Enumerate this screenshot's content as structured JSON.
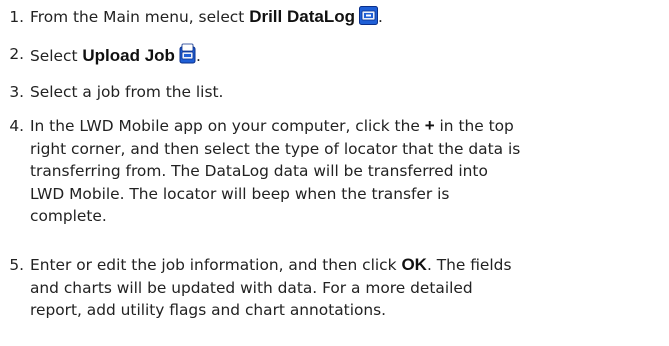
{
  "steps": [
    {
      "number": "1.",
      "prefix": "From the Main menu, select ",
      "emphasis": "Drill DataLog",
      "icon": "drill-datalog-icon",
      "suffix": "."
    },
    {
      "number": "2.",
      "prefix": "Select ",
      "emphasis": "Upload Job",
      "icon": "upload-job-icon",
      "suffix": "."
    },
    {
      "number": "3.",
      "text": "Select a job from the list."
    },
    {
      "number": "4.",
      "line1_prefix": "In the LWD Mobile app on your computer, click the ",
      "plus": "+",
      "line1_suffix": " in the top",
      "line2": "right corner, and then select the type of locator that the data is",
      "line3": "transferring from. The DataLog data will be transferred into",
      "line4": "LWD Mobile. The locator will beep when the transfer is",
      "line5": "complete."
    },
    {
      "number": "5.",
      "line1_prefix": "Enter or edit the job information, and then click ",
      "emphasis": "OK",
      "line1_suffix": ". The fields",
      "line2": "and charts will be updated with data. For a more detailed",
      "line3": "report, add utility flags and chart annotations."
    }
  ],
  "colors": {
    "icon_blue": "#1f5fd6",
    "icon_dark_blue": "#0a2f8a",
    "text": "#222222"
  }
}
